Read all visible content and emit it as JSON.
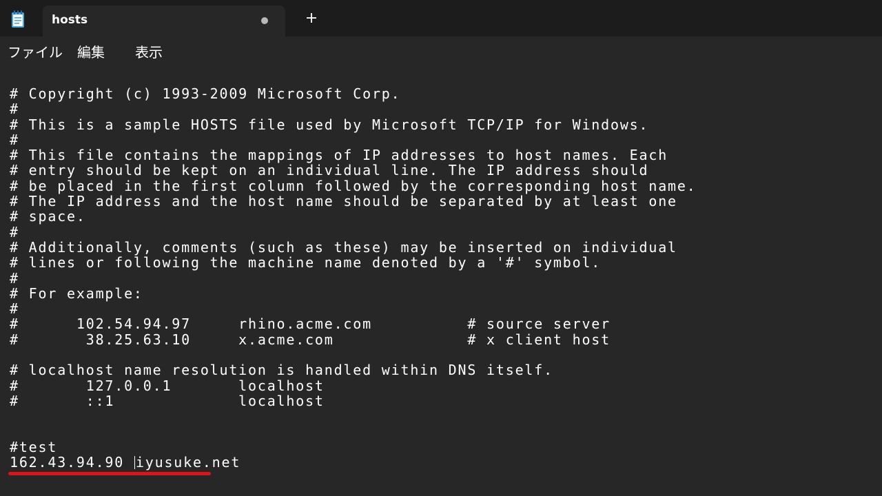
{
  "window": {
    "tab_title": "hosts",
    "tab_unsaved_indicator": "dot-icon",
    "new_tab_icon": "plus-icon",
    "app_icon": "notepad-icon"
  },
  "menu": {
    "items": [
      "ファイル",
      "編集",
      "表示"
    ]
  },
  "editor": {
    "lines": [
      "# Copyright (c) 1993-2009 Microsoft Corp.",
      "#",
      "# This is a sample HOSTS file used by Microsoft TCP/IP for Windows.",
      "#",
      "# This file contains the mappings of IP addresses to host names. Each",
      "# entry should be kept on an individual line. The IP address should",
      "# be placed in the first column followed by the corresponding host name.",
      "# The IP address and the host name should be separated by at least one",
      "# space.",
      "#",
      "# Additionally, comments (such as these) may be inserted on individual",
      "# lines or following the machine name denoted by a '#' symbol.",
      "#",
      "# For example:",
      "#",
      "#      102.54.94.97     rhino.acme.com          # source server",
      "#       38.25.63.10     x.acme.com              # x client host",
      "",
      "# localhost name resolution is handled within DNS itself.",
      "#       127.0.0.1       localhost",
      "#       ::1             localhost",
      "",
      "",
      "#test"
    ],
    "last_line_before_caret": "162.43.94.90 ",
    "last_line_after_caret": "iyusuke.net"
  },
  "colors": {
    "titlebar_bg": "#1c1c1c",
    "editor_bg": "#272727",
    "text": "#ffffff",
    "highlight_underline": "#e0131a"
  }
}
